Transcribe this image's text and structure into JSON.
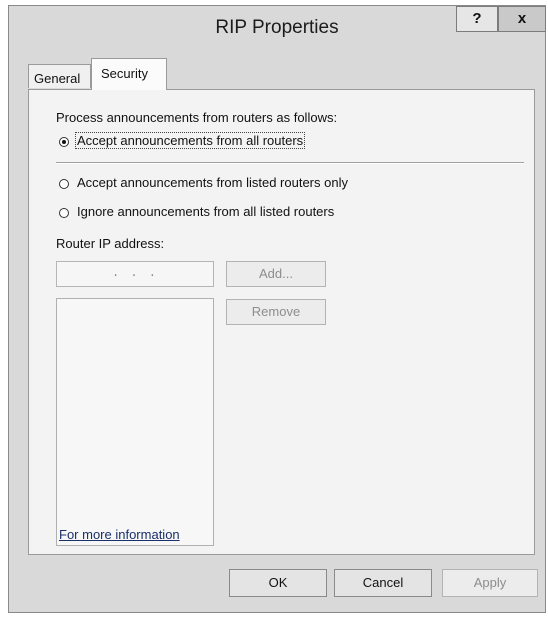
{
  "window": {
    "title": "RIP Properties",
    "help_label": "?",
    "close_label": "x"
  },
  "tabs": [
    {
      "label": "General"
    },
    {
      "label": "Security",
      "active": true
    }
  ],
  "security": {
    "process_label": "Process announcements from routers as follows:",
    "options": [
      {
        "label": "Accept announcements from all routers",
        "selected": true
      },
      {
        "label": "Accept announcements from listed routers only",
        "selected": false
      },
      {
        "label": "Ignore announcements from all listed routers",
        "selected": false
      }
    ],
    "router_ip_label": "Router IP address:",
    "ip_value": ". . .",
    "add_label": "Add...",
    "remove_label": "Remove",
    "router_list": [],
    "more_info_link": "For more information"
  },
  "footer": {
    "ok_label": "OK",
    "cancel_label": "Cancel",
    "apply_label": "Apply"
  },
  "colors": {
    "window_bg": "#d9d9d9",
    "panel_bg": "#f3f3f3",
    "link": "#1a2f6b",
    "disabled_text": "#8d8d8d"
  }
}
